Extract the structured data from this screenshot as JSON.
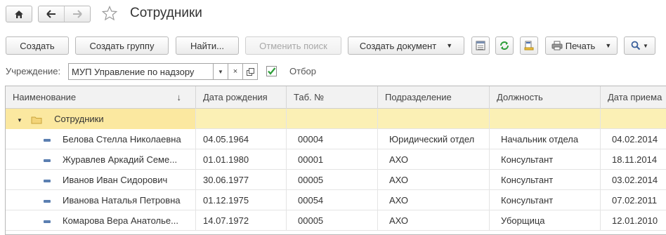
{
  "window": {
    "title": "Сотрудники",
    "nav": {
      "home": "home-icon",
      "back": "arrow-left-icon",
      "forward": "arrow-right-icon"
    },
    "favorite_icon": "star-icon"
  },
  "toolbar": {
    "create": "Создать",
    "create_group": "Создать группу",
    "find": "Найти...",
    "cancel_search": "Отменить поиск",
    "create_document": "Создать документ",
    "print": "Печать",
    "icons": [
      "list-settings-icon",
      "refresh-icon",
      "report-icon",
      "printer-icon",
      "search-icon"
    ]
  },
  "filter": {
    "label": "Учреждение:",
    "value": "МУП Управление по надзору",
    "checkbox_checked": true,
    "checkbox_label": "Отбор"
  },
  "table": {
    "columns": [
      "Наименование",
      "Дата рождения",
      "Таб. №",
      "Подразделение",
      "Должность",
      "Дата приема"
    ],
    "sort_indicator": "↓",
    "group": {
      "name": "Сотрудники"
    },
    "rows": [
      {
        "name": "Белова Стелла Николаевна",
        "birth": "04.05.1964",
        "tab": "00004",
        "dept": "Юридический отдел",
        "position": "Начальник отдела",
        "hire": "04.02.2014"
      },
      {
        "name": "Журавлев Аркадий Семе...",
        "birth": "01.01.1980",
        "tab": "00001",
        "dept": "АХО",
        "position": "Консультант",
        "hire": "18.11.2014"
      },
      {
        "name": "Иванов Иван Сидорович",
        "birth": "30.06.1977",
        "tab": "00005",
        "dept": "АХО",
        "position": "Консультант",
        "hire": "03.02.2014"
      },
      {
        "name": "Иванова Наталья Петровна",
        "birth": "01.12.1975",
        "tab": "00054",
        "dept": "АХО",
        "position": "Консультант",
        "hire": "07.02.2011"
      },
      {
        "name": "Комарова Вера Анатолье...",
        "birth": "14.07.1972",
        "tab": "00005",
        "dept": "АХО",
        "position": "Уборщица",
        "hire": "12.01.2010"
      }
    ]
  },
  "colors": {
    "group_row": "#fbf0b5",
    "check": "#2e9e3a",
    "header": "#f2f2f2"
  }
}
